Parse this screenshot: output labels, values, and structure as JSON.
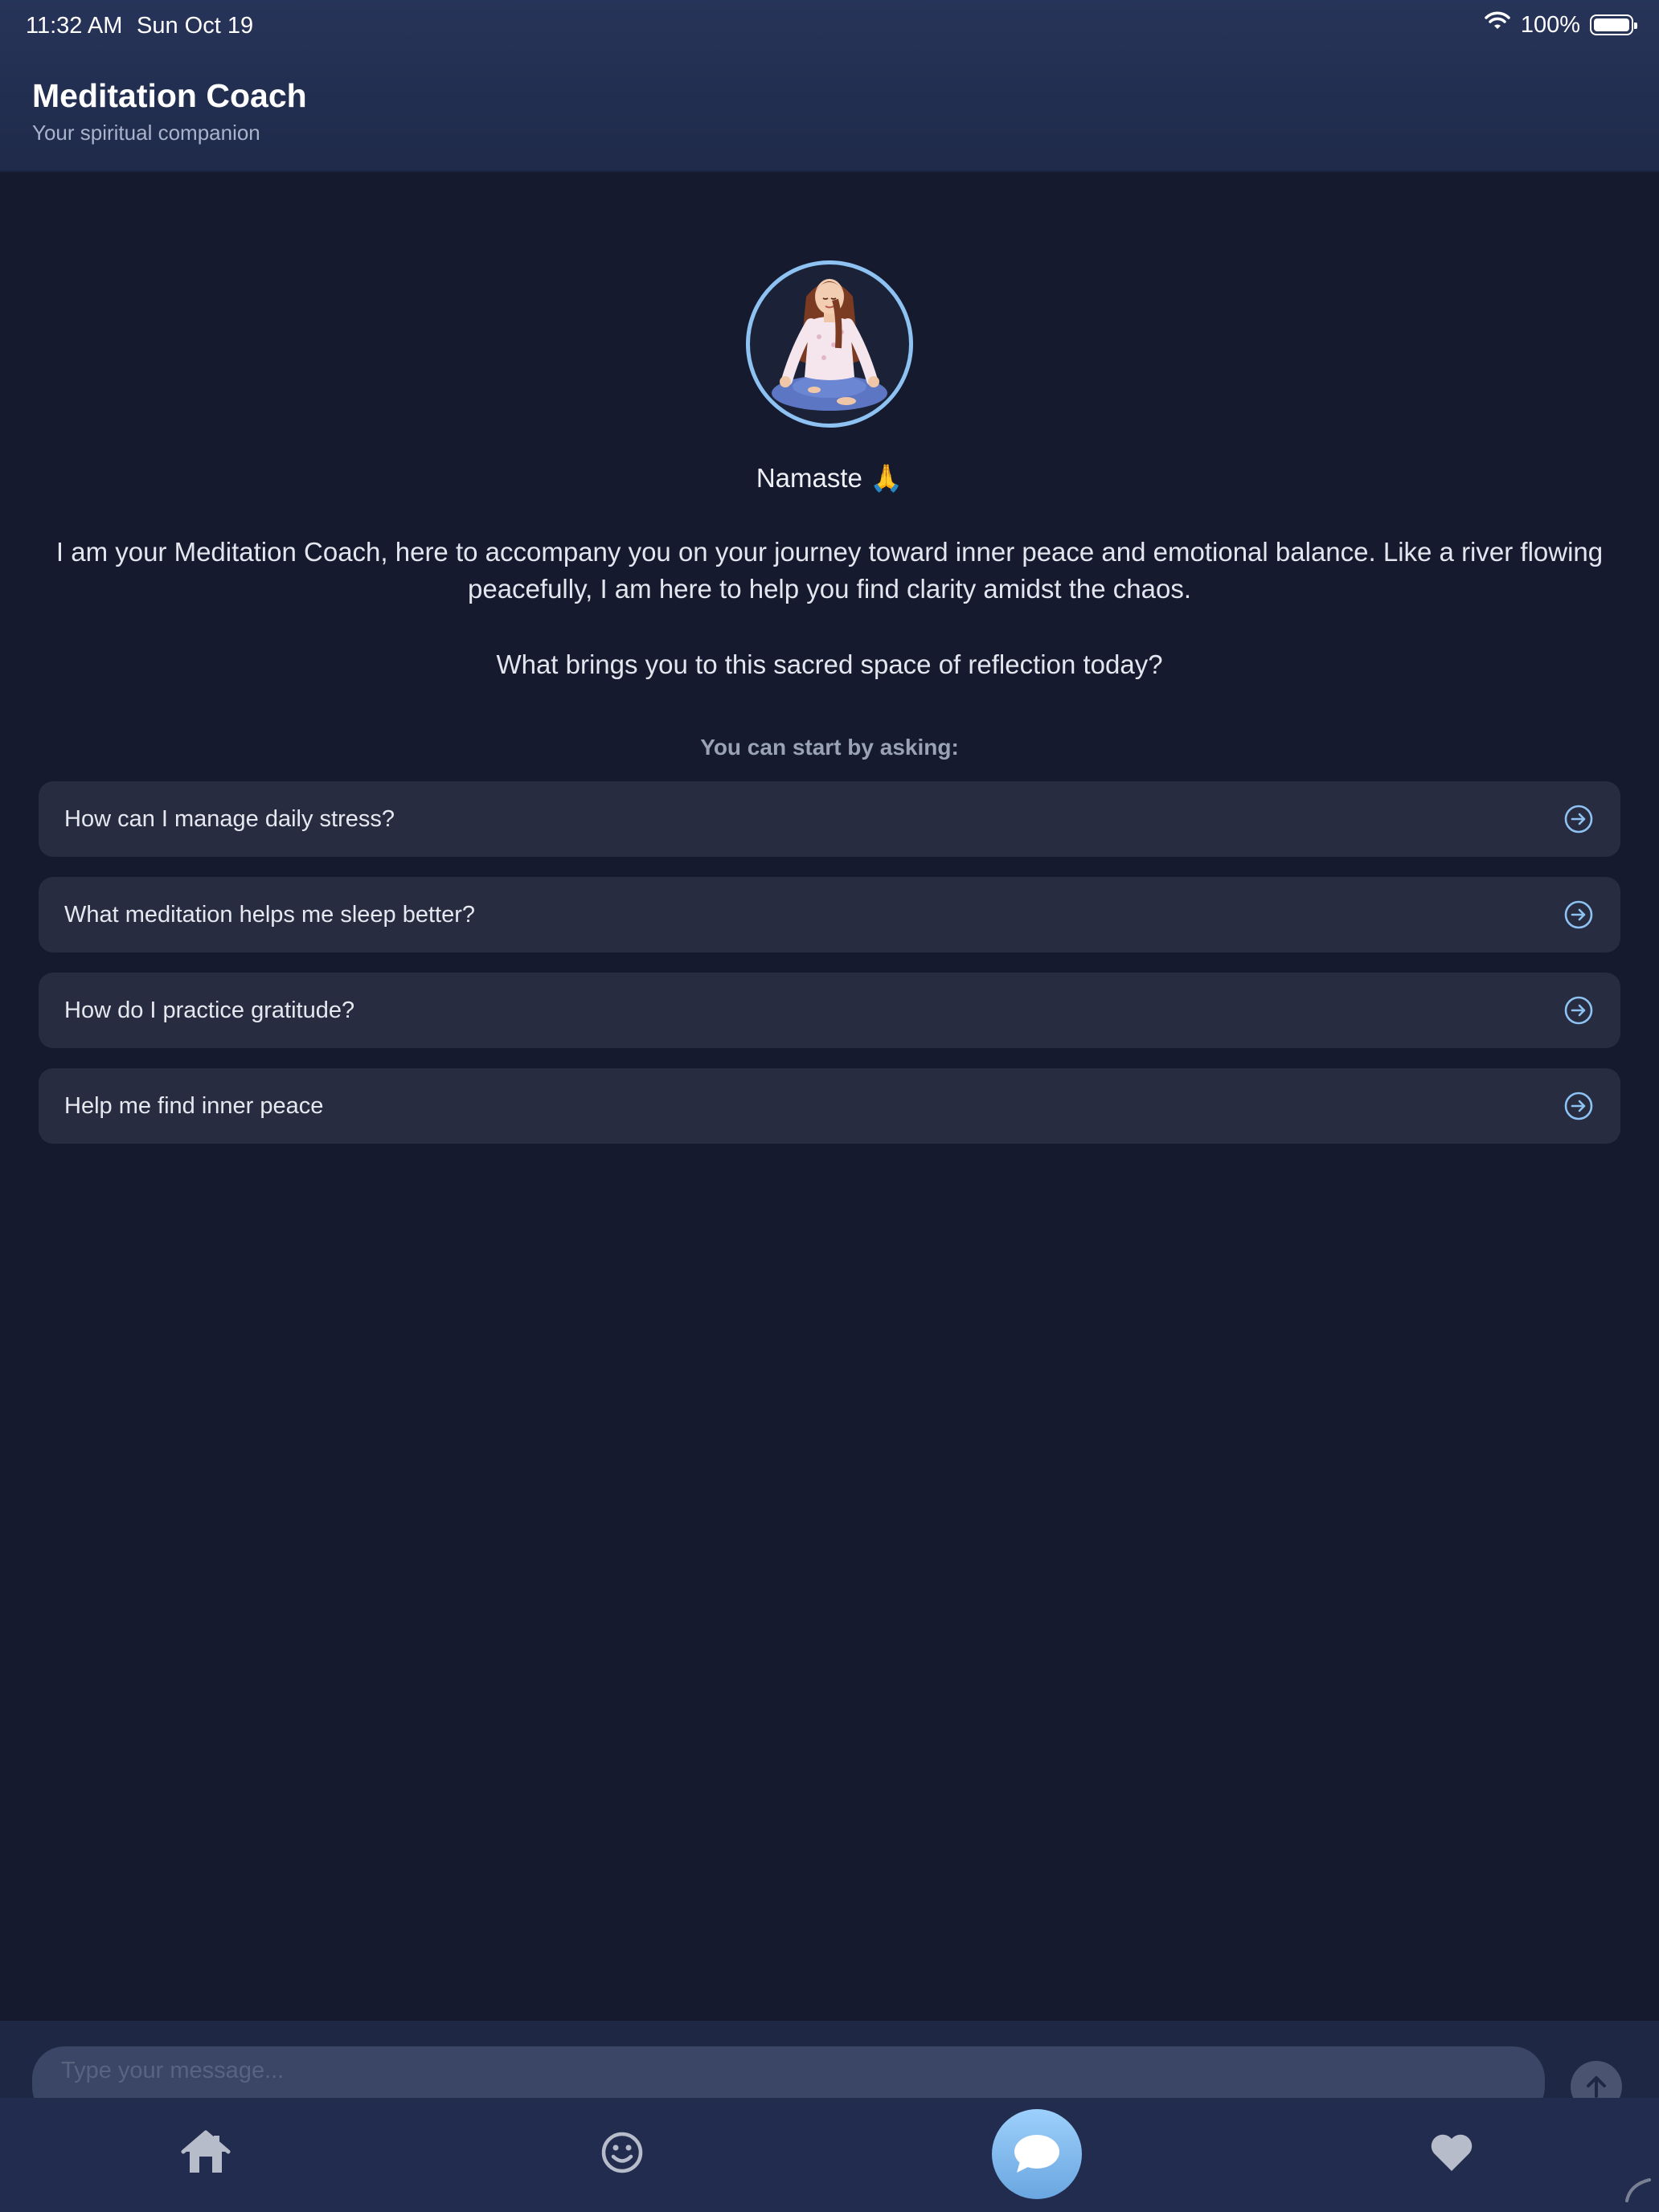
{
  "status_bar": {
    "time": "11:32 AM",
    "date": "Sun Oct 19",
    "battery": "100%",
    "icons": [
      "wifi-icon",
      "battery-icon"
    ]
  },
  "header": {
    "title": "Meditation Coach",
    "subtitle": "Your spiritual companion"
  },
  "welcome": {
    "avatar_icon": "meditating-woman-avatar",
    "greeting": "Namaste 🙏",
    "intro": "I am your Meditation Coach, here to accompany you on your journey toward inner peace and emotional balance. Like a river flowing peacefully, I am here to help you find clarity amidst the chaos.",
    "question": "What brings you to this sacred space of reflection today?"
  },
  "suggestions": {
    "label": "You can start by asking:",
    "items": [
      {
        "text": "How can I manage daily stress?",
        "icon": "arrow-right-circle-icon"
      },
      {
        "text": "What meditation helps me sleep better?",
        "icon": "arrow-right-circle-icon"
      },
      {
        "text": "How do I practice gratitude?",
        "icon": "arrow-right-circle-icon"
      },
      {
        "text": "Help me find inner peace",
        "icon": "arrow-right-circle-icon"
      }
    ]
  },
  "composer": {
    "placeholder": "Type your message...",
    "send_icon": "arrow-up-icon"
  },
  "tab_bar": {
    "tabs": [
      {
        "icon": "home-icon"
      },
      {
        "icon": "smiley-icon"
      },
      {
        "icon": "chat-bubble-icon",
        "active": true
      },
      {
        "icon": "heart-icon"
      }
    ]
  },
  "colors": {
    "background": "#151a2e",
    "header": "#273459",
    "card": "#272c41",
    "accent": "#8ec2f2"
  }
}
